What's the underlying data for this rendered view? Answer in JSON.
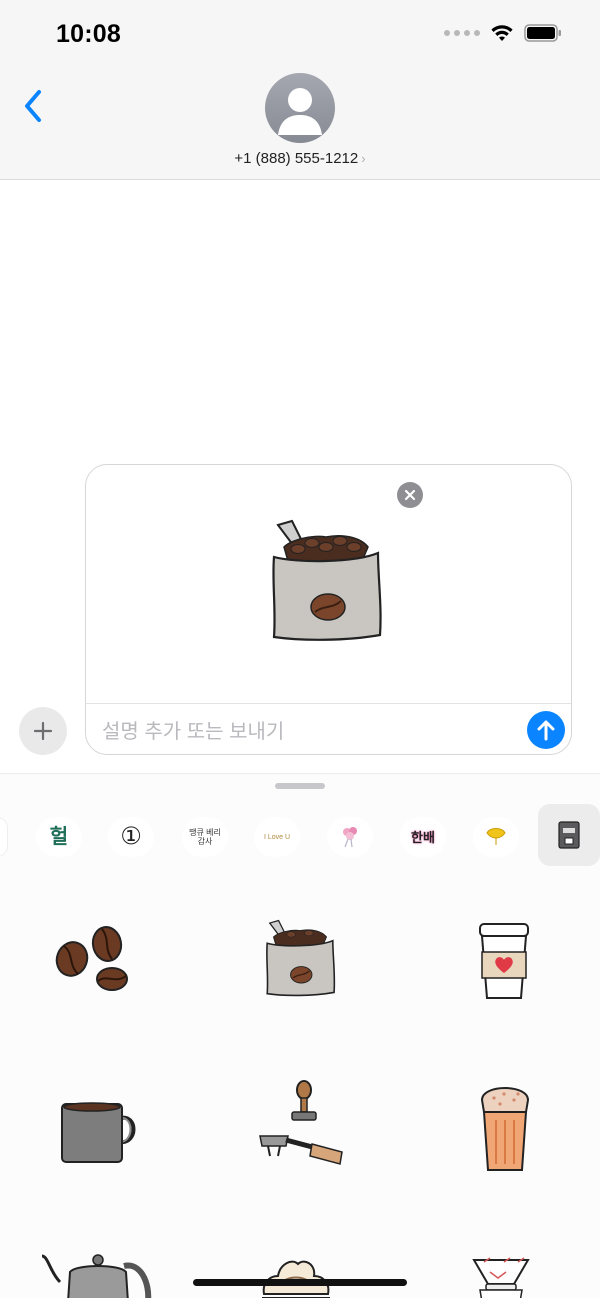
{
  "status_bar": {
    "time": "10:08"
  },
  "header": {
    "contact": "+1 (888) 555-1212",
    "contact_chevron": "›"
  },
  "compose": {
    "placeholder": "설명 추가 또는 보내기",
    "plus_label": "+"
  },
  "drawer": {
    "apps": [
      {
        "name": "sticker-app-heol",
        "text": "헐"
      },
      {
        "name": "sticker-app-numbers",
        "text": "①"
      },
      {
        "name": "sticker-app-ttangyu",
        "text": "땡큐 베리감사"
      },
      {
        "name": "sticker-app-i-love-u",
        "text": "I Love U"
      },
      {
        "name": "sticker-app-flowers",
        "text": ""
      },
      {
        "name": "sticker-app-hanbae",
        "text": "한배"
      },
      {
        "name": "sticker-app-ginkgo",
        "text": ""
      },
      {
        "name": "sticker-app-coffee",
        "text": ""
      }
    ],
    "stickers": [
      "coffee-beans",
      "coffee-bag",
      "takeaway-cup",
      "coffee-mug",
      "portafilter-tamper",
      "iced-latte",
      "pour-over-kettle",
      "whipped-drink",
      "pour-over-dripper"
    ]
  }
}
